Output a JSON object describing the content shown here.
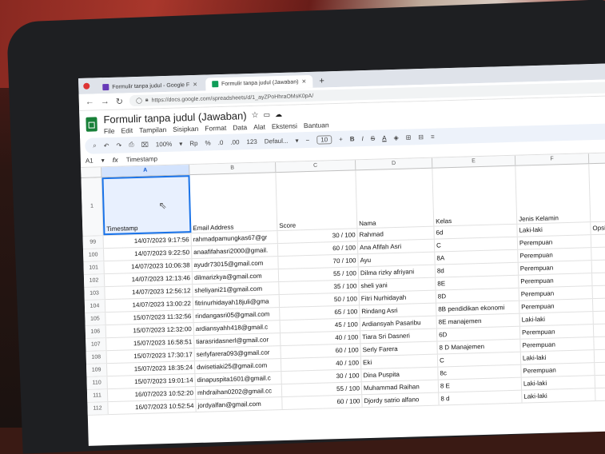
{
  "browser": {
    "tabs": [
      {
        "label": "Formulir tanpa judul - Google F"
      },
      {
        "label": "Formulir tanpa judul (Jawaban)"
      }
    ],
    "url": "https://docs.google.com/spreadsheets/d/1_ayZPoHhraOMsK0pA/"
  },
  "doc": {
    "title": "Formulir tanpa judul (Jawaban)",
    "menu": [
      "File",
      "Edit",
      "Tampilan",
      "Sisipkan",
      "Format",
      "Data",
      "Alat",
      "Ekstensi",
      "Bantuan"
    ]
  },
  "toolbar": {
    "zoom": "100%",
    "currency": "Rp",
    "percent": "%",
    "dec_less": ".0",
    "dec_more": ".00",
    "number_format": "123",
    "font": "Defaul...",
    "font_size": "10",
    "bold": "B",
    "italic": "I",
    "strike": "S",
    "text_color": "A"
  },
  "formula_bar": {
    "cell": "A1",
    "fx": "fx",
    "content": "Timestamp"
  },
  "columns": [
    "A",
    "B",
    "C",
    "D",
    "E",
    "F"
  ],
  "header_row": {
    "num": "1",
    "cells": [
      "Timestamp",
      "Email Address",
      "Score",
      "Nama",
      "Kelas",
      "Jenis Kelamin"
    ]
  },
  "rows": [
    {
      "num": "99",
      "timestamp": "14/07/2023 9:17:56",
      "email": "rahmadpamungkas67@gr",
      "score": "30 / 100",
      "nama": "Rahmad",
      "kelas": "6d",
      "jk": "Laki-laki",
      "g": "Opsi"
    },
    {
      "num": "100",
      "timestamp": "14/07/2023 9:22:50",
      "email": "anaafifahasri2000@gmail.",
      "score": "60 / 100",
      "nama": "Ana Afifah Asri",
      "kelas": "C",
      "jk": "Perempuan",
      "g": ""
    },
    {
      "num": "101",
      "timestamp": "14/07/2023 10:06:38",
      "email": "ayudr73015@gmail.com",
      "score": "70 / 100",
      "nama": "Ayu",
      "kelas": "8A",
      "jk": "Perempuan",
      "g": ""
    },
    {
      "num": "102",
      "timestamp": "14/07/2023 12:13:46",
      "email": "dilmarizkya@gmail.com",
      "score": "55 / 100",
      "nama": "Dilma rizky afriyani",
      "kelas": "8d",
      "jk": "Perempuan",
      "g": ""
    },
    {
      "num": "103",
      "timestamp": "14/07/2023 12:56:12",
      "email": "sheliyani21@gmail.com",
      "score": "35 / 100",
      "nama": "sheli yani",
      "kelas": "8E",
      "jk": "Perempuan",
      "g": ""
    },
    {
      "num": "104",
      "timestamp": "14/07/2023 13:00:22",
      "email": "fitrinurhidayah18juli@gma",
      "score": "50 / 100",
      "nama": "Fitri Nurhidayah",
      "kelas": "8D",
      "jk": "Perempuan",
      "g": ""
    },
    {
      "num": "105",
      "timestamp": "15/07/2023 11:32:56",
      "email": "rindangasri05@gmail.com",
      "score": "65 / 100",
      "nama": "Rindang Asri",
      "kelas": "8B pendidikan ekonomi",
      "jk": "Perempuan",
      "g": ""
    },
    {
      "num": "106",
      "timestamp": "15/07/2023 12:32:00",
      "email": "ardiansyahh418@gmail.c",
      "score": "45 / 100",
      "nama": "Ardiansyah Pasaribu",
      "kelas": "8E manajemen",
      "jk": "Laki-laki",
      "g": ""
    },
    {
      "num": "107",
      "timestamp": "15/07/2023 16:58:51",
      "email": "tiarasridasnerl@gmail.cor",
      "score": "40 / 100",
      "nama": "Tiara Sri Dasneri",
      "kelas": "6D",
      "jk": "Perempuan",
      "g": ""
    },
    {
      "num": "108",
      "timestamp": "15/07/2023 17:30:17",
      "email": "serlyfarera093@gmail.cor",
      "score": "60 / 100",
      "nama": "Serly Farera",
      "kelas": "8 D Manajemen",
      "jk": "Perempuan",
      "g": ""
    },
    {
      "num": "109",
      "timestamp": "15/07/2023 18:35:24",
      "email": "dwisetiaki25@gmail.com",
      "score": "40 / 100",
      "nama": "Eki",
      "kelas": "C",
      "jk": "Laki-laki",
      "g": ""
    },
    {
      "num": "110",
      "timestamp": "15/07/2023 19:01:14",
      "email": "dinapuspita1601@gmail.c",
      "score": "30 / 100",
      "nama": "Dina Puspita",
      "kelas": "8c",
      "jk": "Perempuan",
      "g": ""
    },
    {
      "num": "111",
      "timestamp": "16/07/2023 10:52:20",
      "email": "mhdraihan0202@gmail.cc",
      "score": "55 / 100",
      "nama": "Muhammad Raihan",
      "kelas": "8 E",
      "jk": "Laki-laki",
      "g": ""
    },
    {
      "num": "112",
      "timestamp": "16/07/2023 10:52:54",
      "email": "jordyalfan@gmail.com",
      "score": "60 / 100",
      "nama": "Djordy satrio alfano",
      "kelas": "8 d",
      "jk": "Laki-laki",
      "g": ""
    }
  ]
}
